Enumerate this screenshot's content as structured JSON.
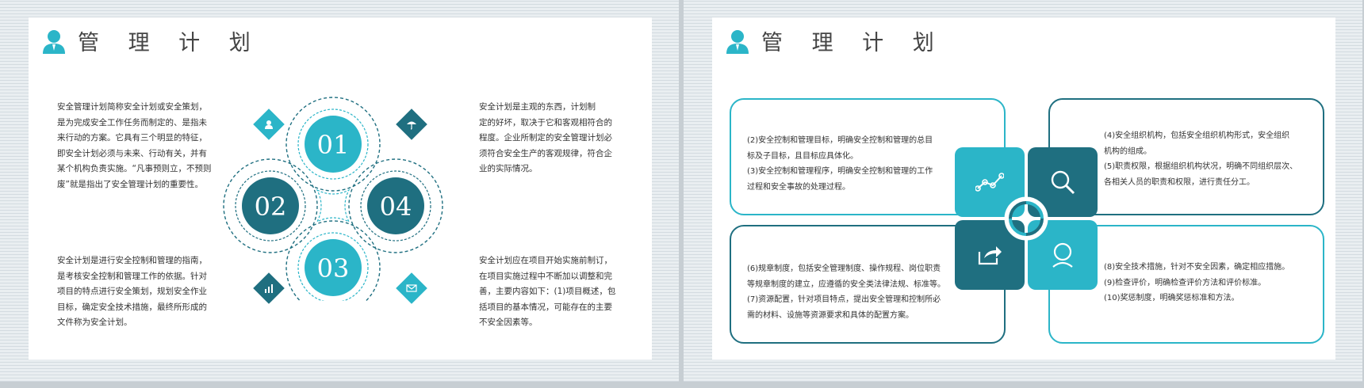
{
  "left_slide": {
    "title": "管 理 计 划",
    "para_top_left": "安全管理计划简称安全计划或安全策划，\n是为完成安全工作任务而制定的、是指未\n来行动的方案。它具有三个明显的特征，\n即安全计划必须与未来、行动有关，并有\n某个机构负责实施。“凡事预则立，不预则\n废”就是指出了安全管理计划的重要性。",
    "para_bottom_left": "安全计划是进行安全控制和管理的指南，\n是考核安全控制和管理工作的依据。针对\n项目的特点进行安全策划，规划安全作业\n目标，确定安全技术措施，最终所形成的\n文件称为安全计划。",
    "para_top_right": "安全计划是主观的东西，计划制\n定的好坏，取决于它和客观相符合的\n程度。企业所制定的安全管理计划必\n须符合安全生产的客观规律，符合企\n业的实际情况。",
    "para_bottom_right": "安全计划应在项目开始实施前制订，\n在项目实施过程中不断加以调整和完\n善，主要内容如下：(1)项目概述，包\n括项目的基本情况，可能存在的主要\n不安全因素等。",
    "nums": [
      "01",
      "02",
      "03",
      "04"
    ],
    "colors": {
      "teal": "#2bb5c8",
      "dark": "#1f6f80"
    }
  },
  "right_slide": {
    "title": "管 理 计 划",
    "box_tl": "(2)安全控制和管理目标，明确安全控制和管理的总目\n标及子目标，且目标应具体化。\n(3)安全控制和管理程序，明确安全控制和管理的工作\n过程和安全事故的处理过程。",
    "box_tr": "(4)安全组织机构，包括安全组织机构形式，安全组织\n机构的组成。\n(5)职责权限，根据组织机构状况，明确不同组织层次、\n各相关人员的职责和权限，进行责任分工。",
    "box_bl": "(6)规章制度，包括安全管理制度、操作规程、岗位职责\n等规章制度的建立，应遵循的安全类法律法规、标准等。\n(7)资源配置，针对项目特点，提出安全管理和控制所必\n需的材料、设施等资源要求和具体的配置方案。",
    "box_br": "(8)安全技术措施，针对不安全因素，确定相应措施。\n(9)检查评价，明确检查评价方法和评价标准。\n(10)奖惩制度，明确奖惩标准和方法。",
    "icons": [
      "chart-line-icon",
      "magnifier-icon",
      "share-icon",
      "user-icon"
    ]
  }
}
